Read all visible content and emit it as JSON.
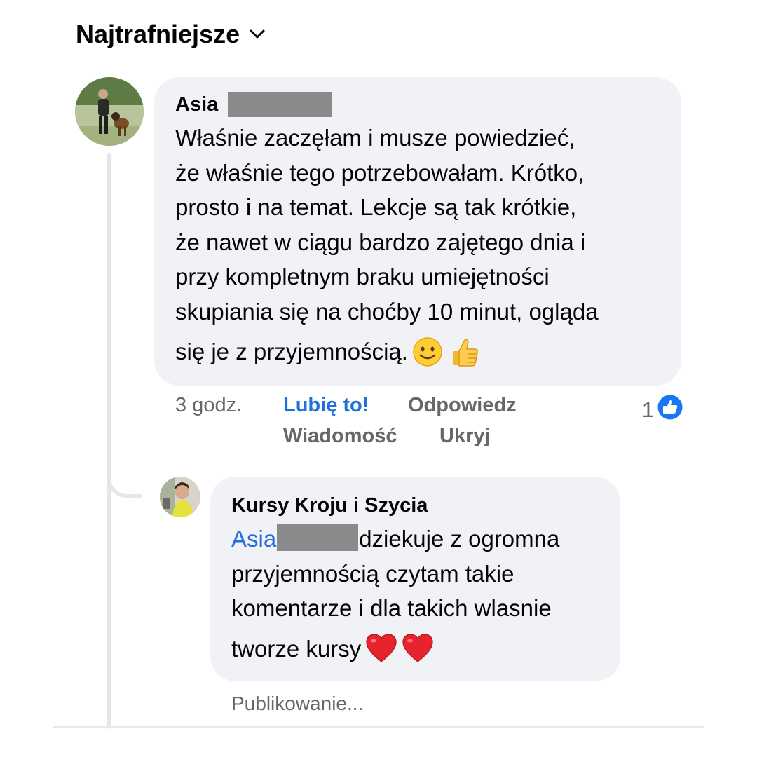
{
  "sort": {
    "label": "Najtrafniejsze",
    "icon": "chevron-down-icon"
  },
  "comment": {
    "author": "Asia",
    "author_redacted": true,
    "lines": [
      "Właśnie zaczęłam i musze powiedzieć,",
      "że właśnie tego potrzebowałam. Krótko,",
      "prosto i na temat. Lekcje są tak krótkie,",
      "że nawet w ciągu bardzo zajętego dnia i",
      "przy kompletnym braku umiejętności",
      "skupiania się na choćby 10 minut, ogląda"
    ],
    "last_line": "się je z przyjemnością.",
    "emojis": [
      "slightly-smiling-face",
      "thumbs-up"
    ],
    "time": "3 godz.",
    "like_label": "Lubię to!",
    "reply_label": "Odpowiedz",
    "message_label": "Wiadomość",
    "hide_label": "Ukryj",
    "reaction_count": "1",
    "reaction_icon": "like-icon",
    "accent_color": "#216fdb"
  },
  "reply": {
    "author": "Kursy Kroju i Szycia",
    "mention": "Asia",
    "mention_redacted": true,
    "first_line_rest": "dziekuje z ogromna",
    "lines": [
      "przyjemnością czytam takie",
      "komentarze i dla takich wlasnie"
    ],
    "last_line": "tworze kursy",
    "emojis": [
      "red-heart",
      "red-heart"
    ],
    "status": "Publikowanie..."
  },
  "colors": {
    "bubble": "#f0f2f5",
    "meta_text": "#65676b",
    "link_blue": "#216fdb",
    "thread_line": "#e4e6eb"
  }
}
